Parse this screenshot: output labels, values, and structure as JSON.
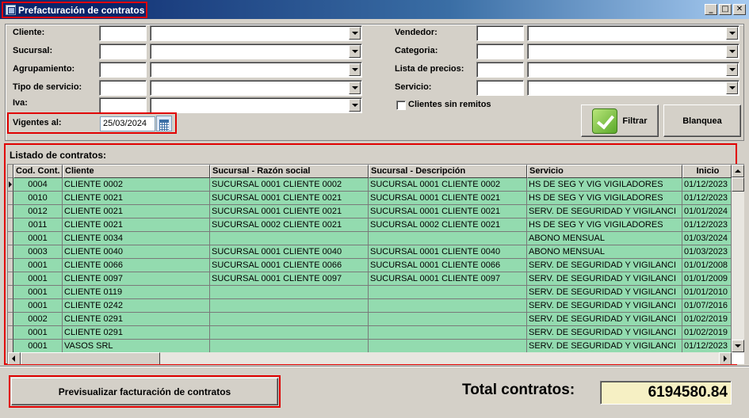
{
  "window": {
    "title": "Prefacturación de contratos",
    "minimize": "_",
    "maximize": "□",
    "close": "✕"
  },
  "filters": {
    "cliente_label": "Cliente:",
    "sucursal_label": "Sucursal:",
    "agrupamiento_label": "Agrupamiento:",
    "tipo_servicio_label": "Tipo de servicio:",
    "iva_label": "Iva:",
    "vendedor_label": "Vendedor:",
    "categoria_label": "Categoria:",
    "lista_precios_label": "Lista de precios:",
    "servicio_label": "Servicio:",
    "clientes_sin_remitos_label": "Clientes sin remitos",
    "vigentes_label": "Vigentes al:",
    "vigentes_value": "25/03/2024"
  },
  "buttons": {
    "filtrar": "Filtrar",
    "blanquea": "Blanquea",
    "previsualizar": "Previsualizar facturación de contratos"
  },
  "grid": {
    "title": "Listado de contratos:",
    "columns": [
      "Cod. Cont.",
      "Cliente",
      "Sucursal - Razón social",
      "Sucursal - Descripción",
      "Servicio",
      "Inicio"
    ],
    "rows": [
      [
        "0004",
        "CLIENTE 0002",
        "SUCURSAL 0001 CLIENTE 0002",
        "SUCURSAL 0001 CLIENTE 0002",
        "HS DE SEG Y VIG VIGILADORES",
        "01/12/2023"
      ],
      [
        "0010",
        "CLIENTE 0021",
        "SUCURSAL 0001 CLIENTE 0021",
        "SUCURSAL 0001 CLIENTE 0021",
        "HS DE SEG Y VIG VIGILADORES",
        "01/12/2023"
      ],
      [
        "0012",
        "CLIENTE 0021",
        "SUCURSAL 0001 CLIENTE 0021",
        "SUCURSAL 0001 CLIENTE 0021",
        "SERV. DE SEGURIDAD Y VIGILANCI",
        "01/01/2024"
      ],
      [
        "0011",
        "CLIENTE 0021",
        "SUCURSAL 0002 CLIENTE 0021",
        "SUCURSAL 0002 CLIENTE 0021",
        "HS DE SEG Y VIG VIGILADORES",
        "01/12/2023"
      ],
      [
        "0001",
        "CLIENTE 0034",
        "",
        "",
        "ABONO MENSUAL",
        "01/03/2024"
      ],
      [
        "0003",
        "CLIENTE 0040",
        "SUCURSAL 0001 CLIENTE 0040",
        "SUCURSAL 0001 CLIENTE 0040",
        "ABONO MENSUAL",
        "01/03/2023"
      ],
      [
        "0001",
        "CLIENTE 0066",
        "SUCURSAL 0001 CLIENTE 0066",
        "SUCURSAL 0001 CLIENTE 0066",
        "SERV. DE SEGURIDAD Y VIGILANCI",
        "01/01/2008"
      ],
      [
        "0001",
        "CLIENTE 0097",
        "SUCURSAL 0001 CLIENTE 0097",
        "SUCURSAL 0001 CLIENTE 0097",
        "SERV. DE SEGURIDAD Y VIGILANCI",
        "01/01/2009"
      ],
      [
        "0001",
        "CLIENTE 0119",
        "",
        "",
        "SERV. DE SEGURIDAD Y VIGILANCI",
        "01/01/2010"
      ],
      [
        "0001",
        "CLIENTE 0242",
        "",
        "",
        "SERV. DE SEGURIDAD Y VIGILANCI",
        "01/07/2016"
      ],
      [
        "0002",
        "CLIENTE 0291",
        "",
        "",
        "SERV. DE SEGURIDAD Y VIGILANCI",
        "01/02/2019"
      ],
      [
        "0001",
        "CLIENTE 0291",
        "",
        "",
        "SERV. DE SEGURIDAD Y VIGILANCI",
        "01/02/2019"
      ],
      [
        "0001",
        "VASOS SRL",
        "",
        "",
        "SERV. DE SEGURIDAD Y VIGILANCI",
        "01/12/2023"
      ]
    ]
  },
  "totals": {
    "label": "Total contratos:",
    "value": "6194580.84"
  }
}
